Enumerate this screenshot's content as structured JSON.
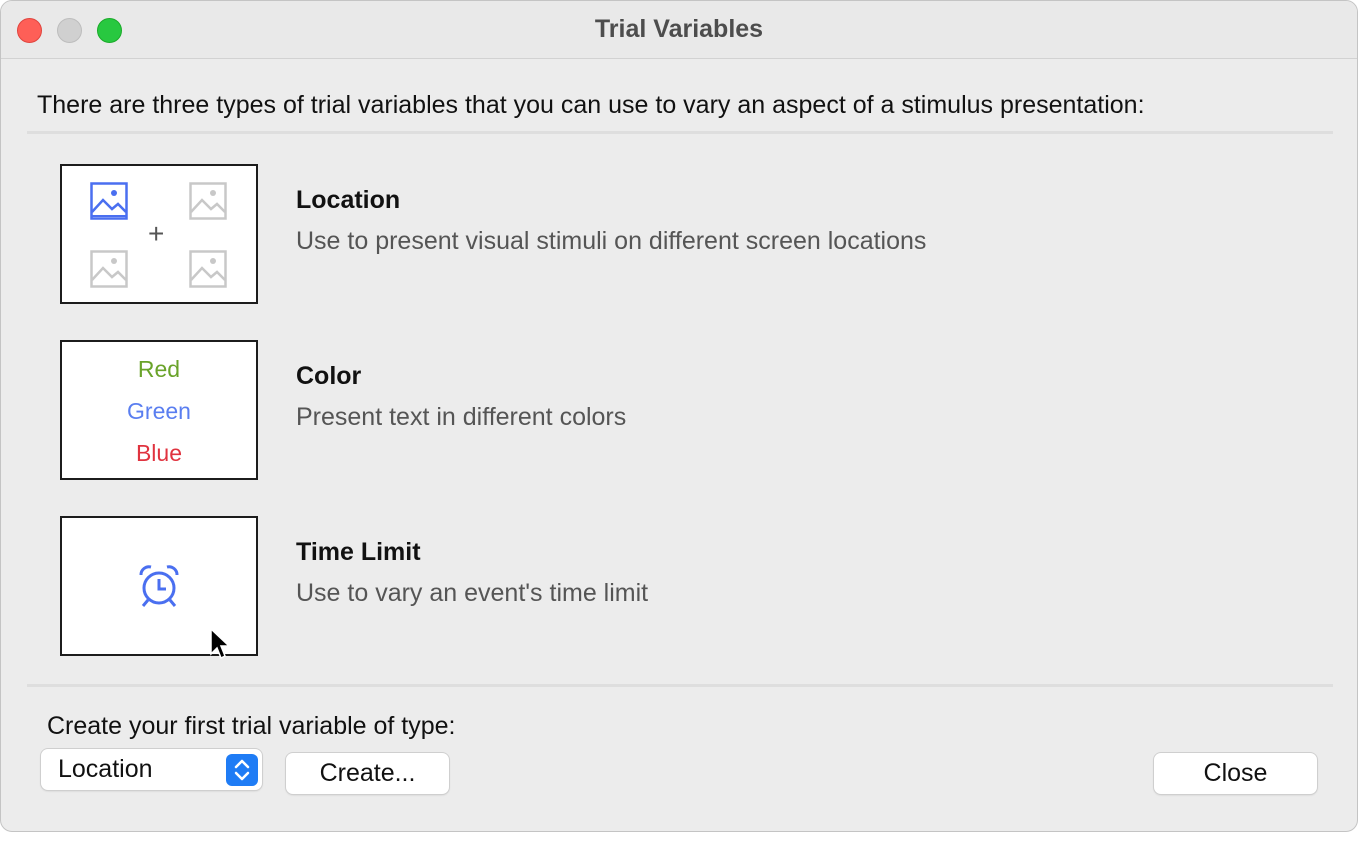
{
  "window": {
    "title": "Trial Variables"
  },
  "intro_text": "There are three types of trial variables that you can use to vary an aspect of a stimulus presentation:",
  "options": [
    {
      "title": "Location",
      "description": "Use to present visual stimuli on different screen locations",
      "icon": "image-grid-icon"
    },
    {
      "title": "Color",
      "description": "Present text in different colors",
      "preview_words": [
        {
          "text": "Red",
          "color": "#6aa32a"
        },
        {
          "text": "Green",
          "color": "#5a7ef0"
        },
        {
          "text": "Blue",
          "color": "#e0333f"
        }
      ]
    },
    {
      "title": "Time Limit",
      "description": "Use to vary an event's time limit",
      "icon": "alarm-clock-icon"
    }
  ],
  "footer": {
    "create_label": "Create your first trial variable of type:",
    "type_select_value": "Location",
    "create_button": "Create...",
    "close_button": "Close"
  },
  "colors": {
    "accent": "#1f7cf5",
    "icon_blue": "#4a6ff0",
    "icon_gray": "#c8c8c8"
  }
}
